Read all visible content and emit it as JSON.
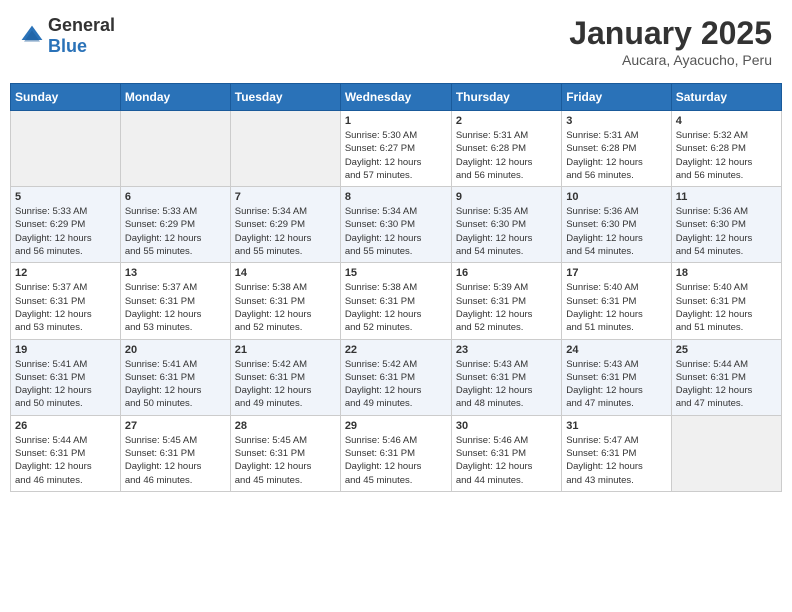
{
  "header": {
    "logo_general": "General",
    "logo_blue": "Blue",
    "month": "January 2025",
    "location": "Aucara, Ayacucho, Peru"
  },
  "days_of_week": [
    "Sunday",
    "Monday",
    "Tuesday",
    "Wednesday",
    "Thursday",
    "Friday",
    "Saturday"
  ],
  "weeks": [
    [
      {
        "day": "",
        "info": ""
      },
      {
        "day": "",
        "info": ""
      },
      {
        "day": "",
        "info": ""
      },
      {
        "day": "1",
        "info": "Sunrise: 5:30 AM\nSunset: 6:27 PM\nDaylight: 12 hours\nand 57 minutes."
      },
      {
        "day": "2",
        "info": "Sunrise: 5:31 AM\nSunset: 6:28 PM\nDaylight: 12 hours\nand 56 minutes."
      },
      {
        "day": "3",
        "info": "Sunrise: 5:31 AM\nSunset: 6:28 PM\nDaylight: 12 hours\nand 56 minutes."
      },
      {
        "day": "4",
        "info": "Sunrise: 5:32 AM\nSunset: 6:28 PM\nDaylight: 12 hours\nand 56 minutes."
      }
    ],
    [
      {
        "day": "5",
        "info": "Sunrise: 5:33 AM\nSunset: 6:29 PM\nDaylight: 12 hours\nand 56 minutes."
      },
      {
        "day": "6",
        "info": "Sunrise: 5:33 AM\nSunset: 6:29 PM\nDaylight: 12 hours\nand 55 minutes."
      },
      {
        "day": "7",
        "info": "Sunrise: 5:34 AM\nSunset: 6:29 PM\nDaylight: 12 hours\nand 55 minutes."
      },
      {
        "day": "8",
        "info": "Sunrise: 5:34 AM\nSunset: 6:30 PM\nDaylight: 12 hours\nand 55 minutes."
      },
      {
        "day": "9",
        "info": "Sunrise: 5:35 AM\nSunset: 6:30 PM\nDaylight: 12 hours\nand 54 minutes."
      },
      {
        "day": "10",
        "info": "Sunrise: 5:36 AM\nSunset: 6:30 PM\nDaylight: 12 hours\nand 54 minutes."
      },
      {
        "day": "11",
        "info": "Sunrise: 5:36 AM\nSunset: 6:30 PM\nDaylight: 12 hours\nand 54 minutes."
      }
    ],
    [
      {
        "day": "12",
        "info": "Sunrise: 5:37 AM\nSunset: 6:31 PM\nDaylight: 12 hours\nand 53 minutes."
      },
      {
        "day": "13",
        "info": "Sunrise: 5:37 AM\nSunset: 6:31 PM\nDaylight: 12 hours\nand 53 minutes."
      },
      {
        "day": "14",
        "info": "Sunrise: 5:38 AM\nSunset: 6:31 PM\nDaylight: 12 hours\nand 52 minutes."
      },
      {
        "day": "15",
        "info": "Sunrise: 5:38 AM\nSunset: 6:31 PM\nDaylight: 12 hours\nand 52 minutes."
      },
      {
        "day": "16",
        "info": "Sunrise: 5:39 AM\nSunset: 6:31 PM\nDaylight: 12 hours\nand 52 minutes."
      },
      {
        "day": "17",
        "info": "Sunrise: 5:40 AM\nSunset: 6:31 PM\nDaylight: 12 hours\nand 51 minutes."
      },
      {
        "day": "18",
        "info": "Sunrise: 5:40 AM\nSunset: 6:31 PM\nDaylight: 12 hours\nand 51 minutes."
      }
    ],
    [
      {
        "day": "19",
        "info": "Sunrise: 5:41 AM\nSunset: 6:31 PM\nDaylight: 12 hours\nand 50 minutes."
      },
      {
        "day": "20",
        "info": "Sunrise: 5:41 AM\nSunset: 6:31 PM\nDaylight: 12 hours\nand 50 minutes."
      },
      {
        "day": "21",
        "info": "Sunrise: 5:42 AM\nSunset: 6:31 PM\nDaylight: 12 hours\nand 49 minutes."
      },
      {
        "day": "22",
        "info": "Sunrise: 5:42 AM\nSunset: 6:31 PM\nDaylight: 12 hours\nand 49 minutes."
      },
      {
        "day": "23",
        "info": "Sunrise: 5:43 AM\nSunset: 6:31 PM\nDaylight: 12 hours\nand 48 minutes."
      },
      {
        "day": "24",
        "info": "Sunrise: 5:43 AM\nSunset: 6:31 PM\nDaylight: 12 hours\nand 47 minutes."
      },
      {
        "day": "25",
        "info": "Sunrise: 5:44 AM\nSunset: 6:31 PM\nDaylight: 12 hours\nand 47 minutes."
      }
    ],
    [
      {
        "day": "26",
        "info": "Sunrise: 5:44 AM\nSunset: 6:31 PM\nDaylight: 12 hours\nand 46 minutes."
      },
      {
        "day": "27",
        "info": "Sunrise: 5:45 AM\nSunset: 6:31 PM\nDaylight: 12 hours\nand 46 minutes."
      },
      {
        "day": "28",
        "info": "Sunrise: 5:45 AM\nSunset: 6:31 PM\nDaylight: 12 hours\nand 45 minutes."
      },
      {
        "day": "29",
        "info": "Sunrise: 5:46 AM\nSunset: 6:31 PM\nDaylight: 12 hours\nand 45 minutes."
      },
      {
        "day": "30",
        "info": "Sunrise: 5:46 AM\nSunset: 6:31 PM\nDaylight: 12 hours\nand 44 minutes."
      },
      {
        "day": "31",
        "info": "Sunrise: 5:47 AM\nSunset: 6:31 PM\nDaylight: 12 hours\nand 43 minutes."
      },
      {
        "day": "",
        "info": ""
      }
    ]
  ]
}
